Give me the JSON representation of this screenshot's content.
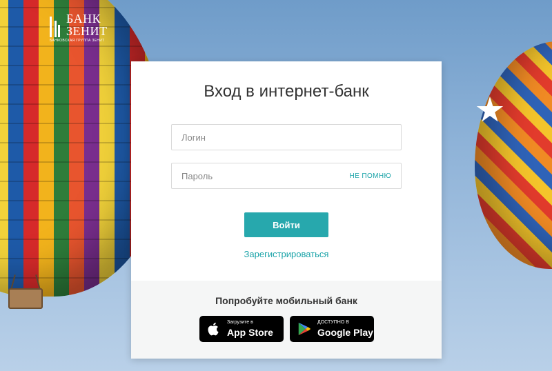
{
  "logo": {
    "line1": "БАНК",
    "line2": "ЗЕНИТ",
    "subtitle": "банковская группа зенит"
  },
  "login": {
    "title": "Вход в интернет-банк",
    "login_placeholder": "Логин",
    "password_placeholder": "Пароль",
    "forgot_label": "НЕ ПОМНЮ",
    "submit_label": "Войти",
    "register_label": "Зарегистрироваться"
  },
  "mobile": {
    "title": "Попробуйте мобильный банк",
    "appstore_small": "Загрузите в",
    "appstore_big": "App Store",
    "googleplay_small": "ДОСТУПНО В",
    "googleplay_big": "Google Play"
  },
  "colors": {
    "accent": "#27a8ad",
    "link": "#1aa3a8"
  },
  "icons": {
    "appstore": "apple-icon",
    "googleplay": "google-play-icon"
  }
}
